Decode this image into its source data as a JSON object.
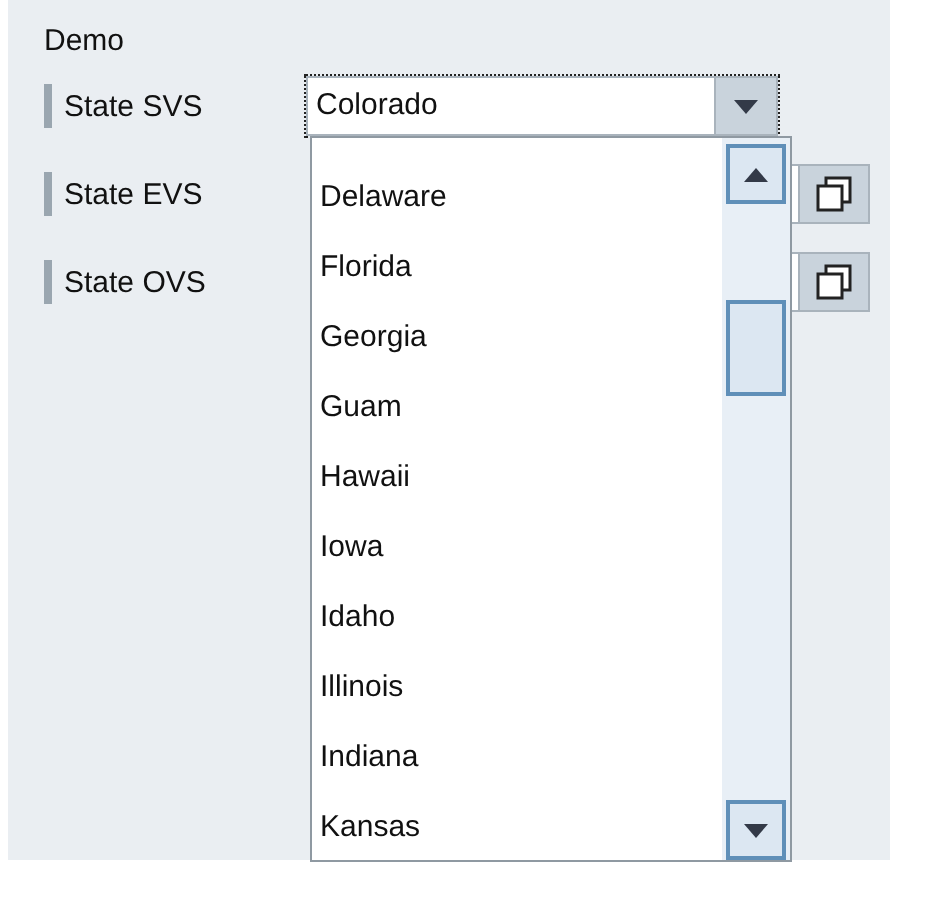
{
  "group_title": "Demo",
  "fields": [
    {
      "label": "State SVS",
      "kind": "combo",
      "value": "Colorado",
      "focused": true,
      "expanded": true,
      "items": [
        "Delaware",
        "Florida",
        "Georgia",
        "Guam",
        "Hawaii",
        "Iowa",
        "Idaho",
        "Illinois",
        "Indiana",
        "Kansas"
      ]
    },
    {
      "label": "State EVS",
      "kind": "valuehelp"
    },
    {
      "label": "State OVS",
      "kind": "valuehelp"
    }
  ]
}
